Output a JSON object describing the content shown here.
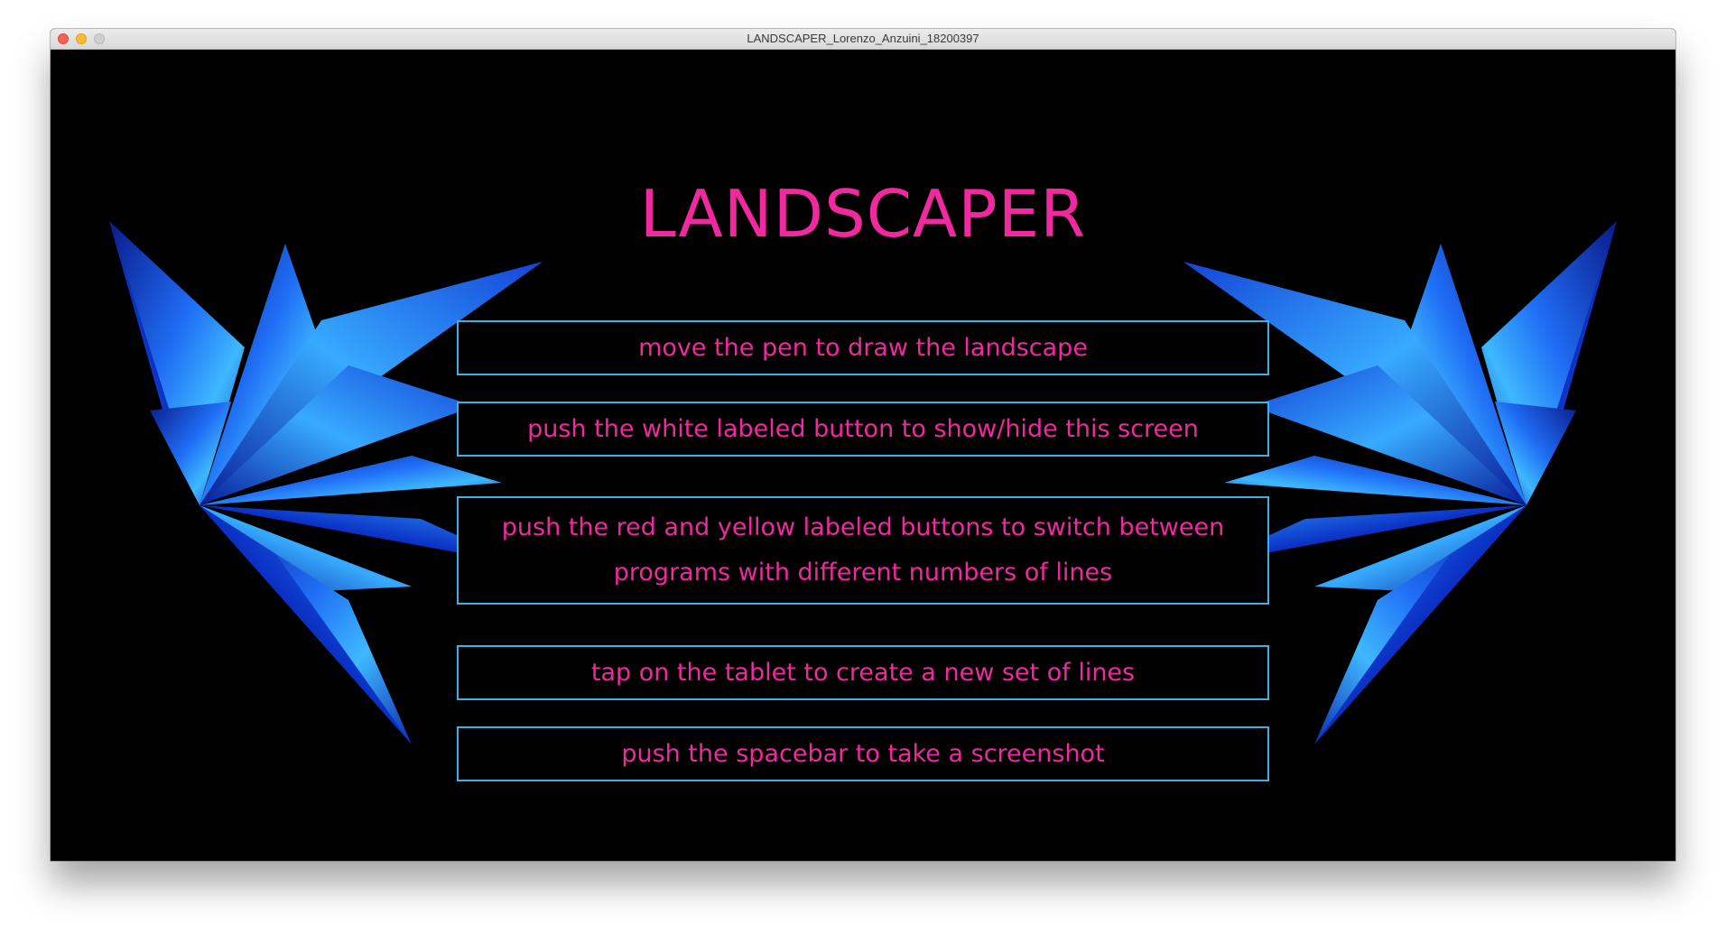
{
  "window": {
    "title": "LANDSCAPER_Lorenzo_Anzuini_18200397"
  },
  "app": {
    "title": "LANDSCAPER",
    "accent_color": "#f02a9e",
    "border_color": "#3fb0e6",
    "instructions": [
      "move the pen to draw the landscape",
      "push the white labeled button to show/hide this screen",
      "push the red and yellow labeled buttons to switch between programs with different numbers of lines",
      "tap on the tablet to create a new set of lines",
      "push the spacebar to take a screenshot"
    ]
  }
}
